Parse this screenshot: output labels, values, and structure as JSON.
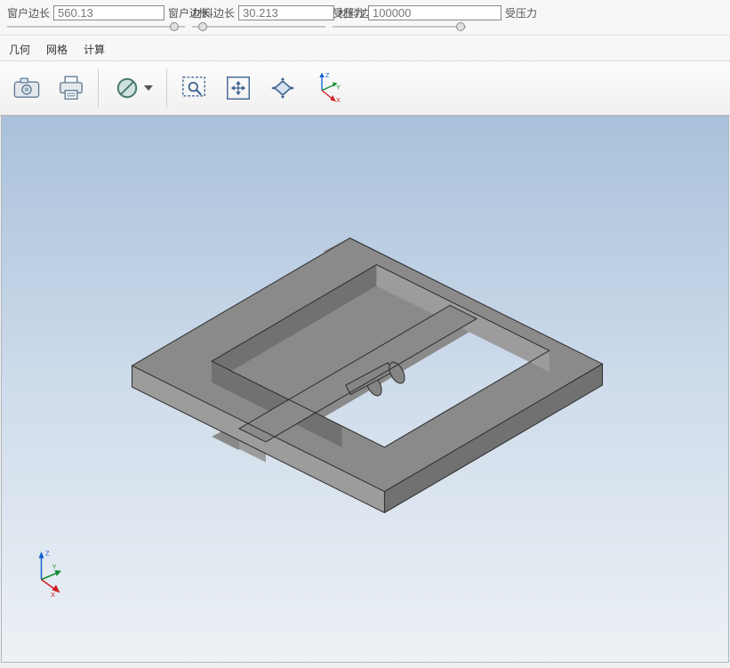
{
  "params": {
    "window_len_label_pre": "窗户边长",
    "window_len_value": "560.13",
    "window_len_label_post": "窗户边长",
    "material_len_label_pre": "材料边长",
    "material_len_value": "30.213",
    "material_len_label_post": "材料边长",
    "pressure_label_pre": "受压力",
    "pressure_value": "100000",
    "pressure_label_post": "受压力"
  },
  "tabs": {
    "geometry": "几何",
    "mesh": "网格",
    "compute": "计算"
  },
  "icons": {
    "camera": "camera-icon",
    "print": "print-icon",
    "not": "not-allowed-icon",
    "zoomsel": "zoom-select-icon",
    "move": "move-icon",
    "rotate": "rotate-icon"
  },
  "toolbar_axis": {
    "x": "X",
    "y": "Y",
    "z": "Z"
  },
  "triad": {
    "x": "X",
    "y": "Y",
    "z": "Z"
  }
}
